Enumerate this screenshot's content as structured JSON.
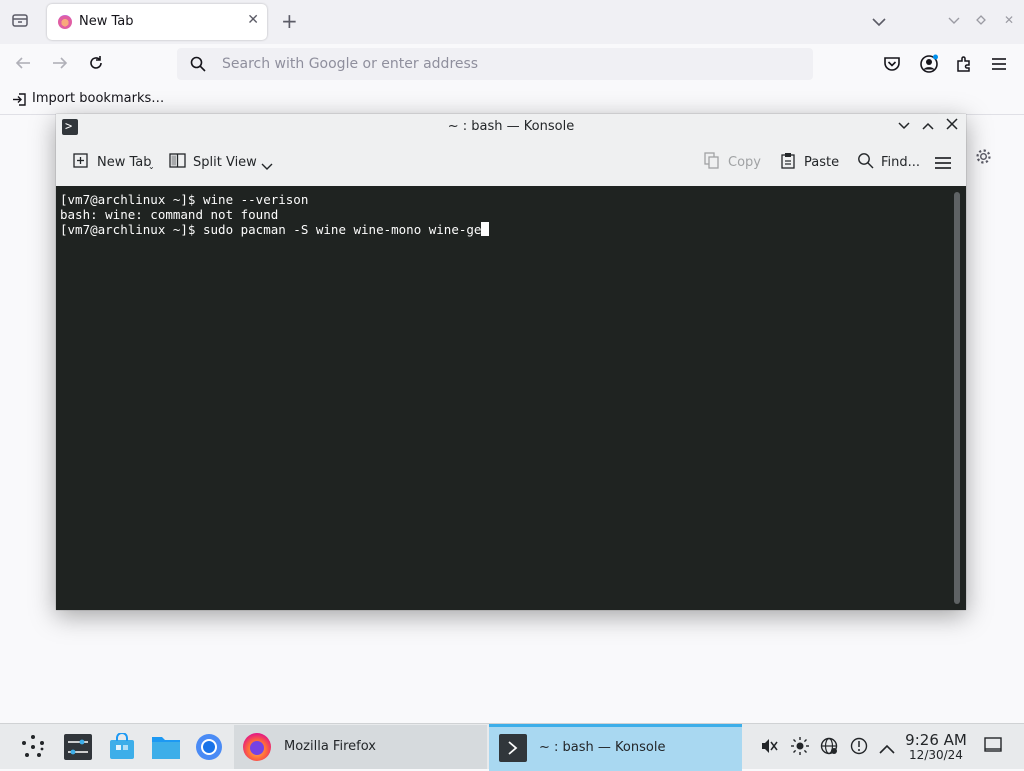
{
  "firefox": {
    "tab_title": "New Tab",
    "new_tab_symbol": "+",
    "url_placeholder": "Search with Google or enter address",
    "bookmarks_import_label": "Import bookmarks…",
    "icons": [
      "tab-list-icon",
      "firefox-favicon",
      "close-tab-icon",
      "new-tab-icon",
      "list-all-tabs-icon",
      "minimize-icon",
      "maximize-icon",
      "close-window-icon",
      "back-icon",
      "forward-icon",
      "reload-icon",
      "search-icon",
      "pocket-icon",
      "account-icon",
      "extensions-icon",
      "menu-icon",
      "import-icon",
      "settings-gear-icon"
    ]
  },
  "konsole": {
    "title": "~ : bash — Konsole",
    "toolbar": {
      "new_tab": "New Tab",
      "split_view": "Split View",
      "copy": "Copy",
      "paste": "Paste",
      "find": "Find..."
    },
    "terminal_lines": [
      "[vm7@archlinux ~]$ wine --verison",
      "bash: wine: command not found",
      "[vm7@archlinux ~]$ sudo pacman -S wine wine-mono wine-ge"
    ],
    "colors": {
      "terminal_bg": "#1f2321",
      "terminal_fg": "#fcfcfc"
    }
  },
  "taskbar": {
    "tasks": [
      {
        "label": "Mozilla Firefox"
      },
      {
        "label": "~ : bash — Konsole"
      }
    ],
    "clock": {
      "time": "9:26 AM",
      "date": "12/30/24"
    },
    "colors": {
      "active_task": "#a9d8f1",
      "accent": "#3daee9"
    }
  }
}
